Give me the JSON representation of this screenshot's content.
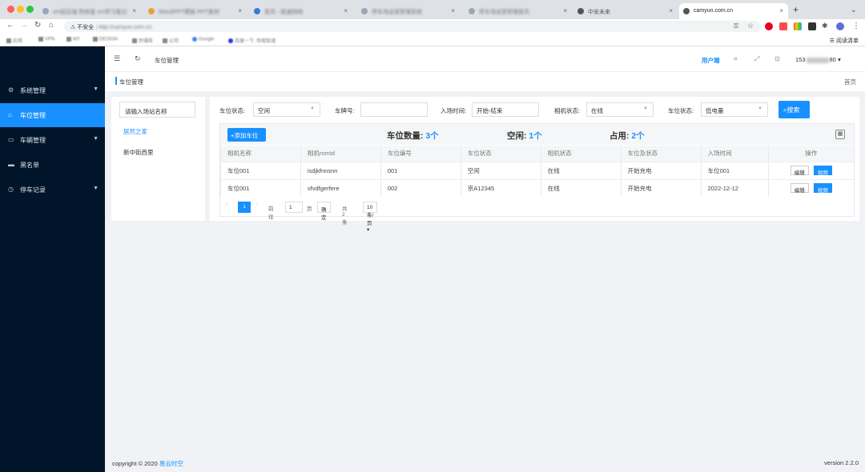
{
  "browser": {
    "tabs": [
      {
        "label": "vm前后端 热修复 vm学习笔记",
        "blurred": true
      },
      {
        "label": "Word/PPT模板 PPT素材",
        "blurred": true
      },
      {
        "label": "首页 - 极速网络",
        "blurred": true
      },
      {
        "label": "停车场运营管理系统",
        "blurred": true
      },
      {
        "label": "停车场运营管理首页",
        "blurred": true
      },
      {
        "label": "中安未来",
        "blurred": false
      },
      {
        "label": "camyun.com.cn",
        "blurred": false
      }
    ],
    "address": {
      "security": "不安全",
      "url": "http://camyun.com.cn"
    },
    "bookmarks": [
      "应用",
      "VPN",
      "MY",
      "DESIGN",
      "存储库",
      "公司",
      "Google",
      "百度一下, 你就知道"
    ],
    "reading_list": "阅读清单"
  },
  "sidebar": {
    "items": [
      {
        "label": "系统管理",
        "icon": "settings-icon",
        "has_arrow": true
      },
      {
        "label": "车位管理",
        "icon": "home-icon",
        "has_arrow": false,
        "active": true
      },
      {
        "label": "车辆管理",
        "icon": "car-icon",
        "has_arrow": true
      },
      {
        "label": "黑名单",
        "icon": "blacklist-icon",
        "has_arrow": false
      },
      {
        "label": "停车记录",
        "icon": "clock-icon",
        "has_arrow": true
      }
    ]
  },
  "topnav": {
    "breadcrumb": "车位管理",
    "user_link": "用户端",
    "phone_prefix": "153",
    "phone_suffix": "80"
  },
  "subbar": {
    "title": "车位管理",
    "home": "首页"
  },
  "leftpanel": {
    "input_placeholder": "请输入场站名称",
    "sites": [
      "居然之家",
      "新中街西里"
    ]
  },
  "filters": {
    "space_status_label": "车位状态:",
    "space_status_value": "空闲",
    "plate_label": "车牌号:",
    "plate_value": "",
    "entry_time_label": "入场时间:",
    "entry_time_value": "开始-结束",
    "camera_status_label": "相机状态:",
    "camera_status_value": "在线",
    "space_status2_label": "车位状态:",
    "space_status2_value": "低电量",
    "search_button": "搜索"
  },
  "table": {
    "add_button": "添加车位",
    "stats": {
      "count_label": "车位数量:",
      "count_value": "3个",
      "free_label": "空闲:",
      "free_value": "1个",
      "used_label": "占用:",
      "used_value": "2个"
    },
    "columns": [
      "相机名称",
      "相机romId",
      "车位编号",
      "车位状态",
      "相机状态",
      "车位及状态",
      "入场时间",
      "操作"
    ],
    "rows": [
      {
        "camera_name": "车位001",
        "rom_id": "isdjkfnnsnn",
        "space_no": "001",
        "space_status": "空闲",
        "camera_status": "在线",
        "charge_status": "开始充电",
        "entry_time": "车位001"
      },
      {
        "camera_name": "车位001",
        "rom_id": "vfvdfgerfere",
        "space_no": "002",
        "space_status": "京A12345",
        "camera_status": "在线",
        "charge_status": "开始充电",
        "entry_time": "2022-12-12"
      }
    ],
    "op_edit": "编辑",
    "op_video": "视频"
  },
  "pager": {
    "current": "1",
    "goto_label": "前往",
    "goto_value": "1",
    "page_unit": "页",
    "confirm": "确定",
    "total": "共 2 条",
    "page_size": "10 条/页"
  },
  "footer": {
    "copyright": "copyright © 2020",
    "brand": "易云时空",
    "version": "version 2.2.0"
  },
  "colors": {
    "primary": "#1890ff",
    "sidebar_bg": "#001529"
  }
}
